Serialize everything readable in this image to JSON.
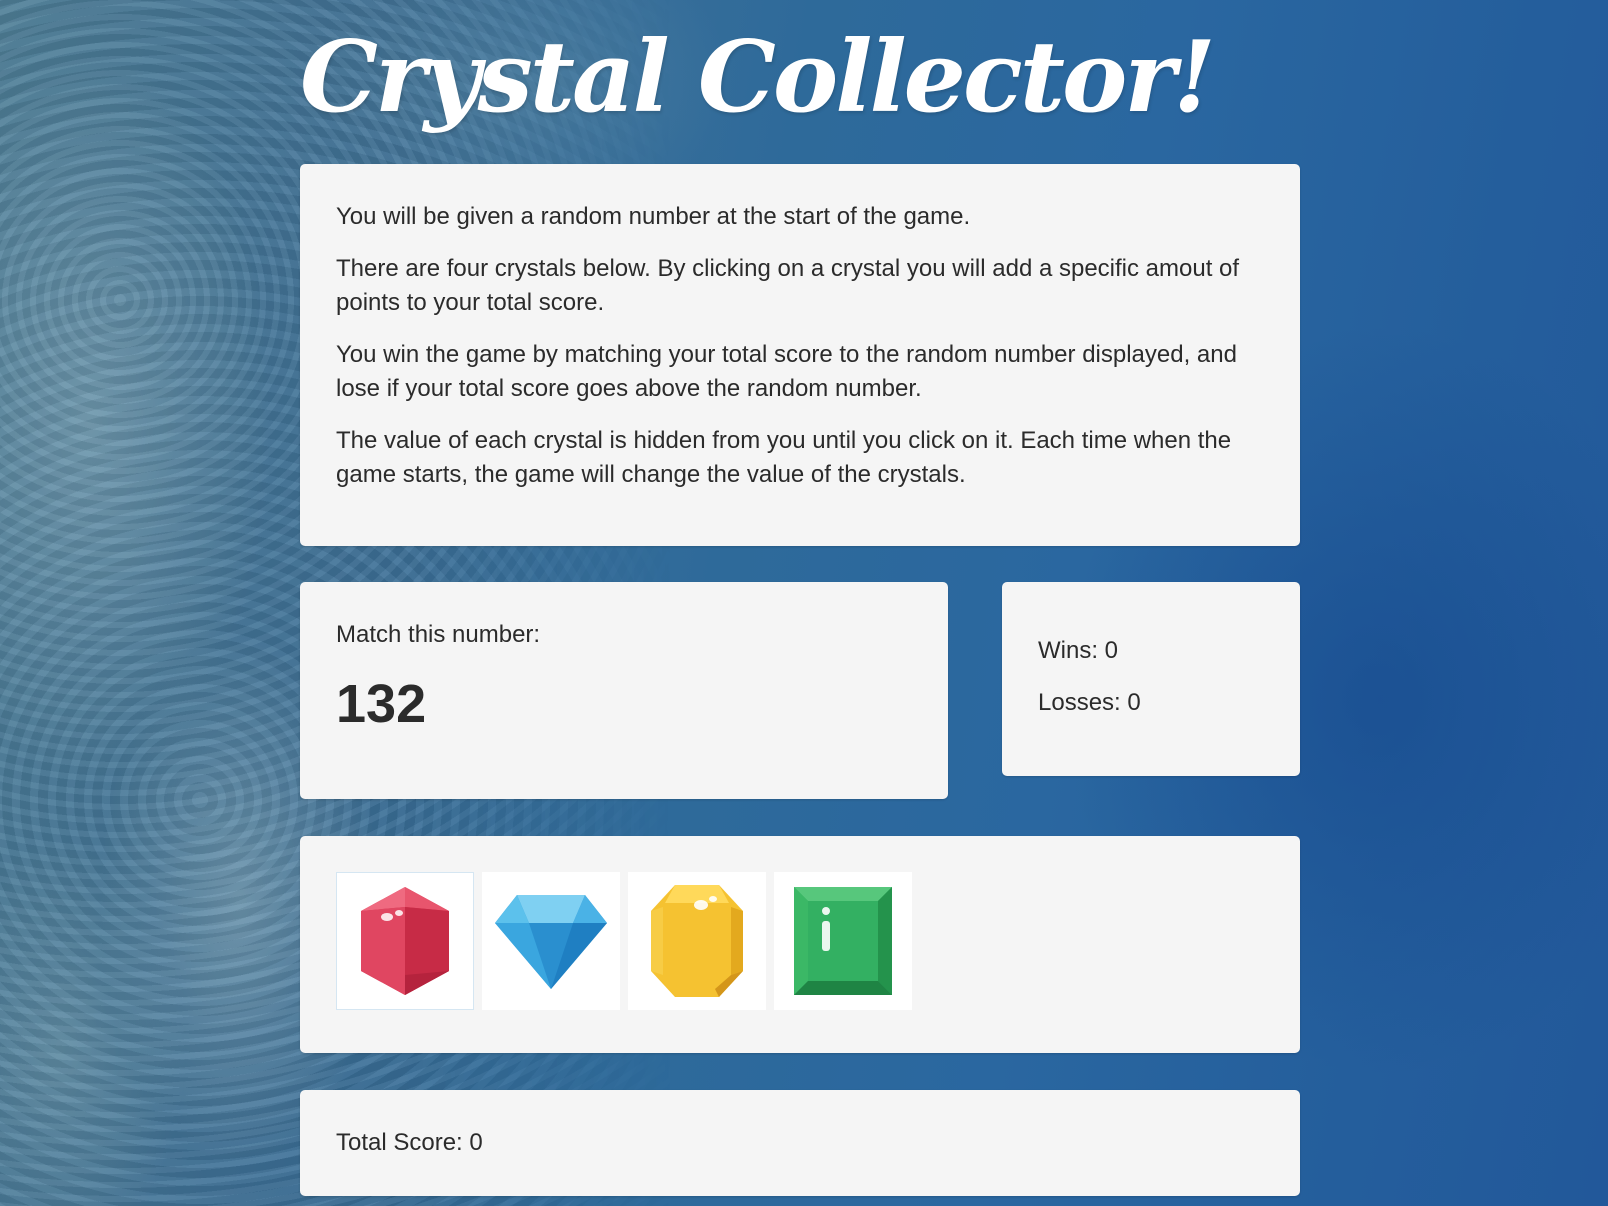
{
  "title": "Crystal Collector!",
  "instructions": [
    "You will be given a random number at the start of the game.",
    "There are four crystals below. By clicking on a crystal you will add a specific amout of points to your total score.",
    "You win the game by matching your total score to the random number displayed, and lose if your total score goes above the random number.",
    "The value of each crystal is hidden from you until you click on it. Each time when the game starts, the game will change the value of the crystals."
  ],
  "target": {
    "label": "Match this number:",
    "value": "132"
  },
  "scoreboard": {
    "wins": "Wins: 0",
    "losses": "Losses: 0"
  },
  "crystals": [
    {
      "name": "ruby-crystal-icon",
      "color": "#d9334f"
    },
    {
      "name": "diamond-crystal-icon",
      "color": "#2f9ad8"
    },
    {
      "name": "topaz-crystal-icon",
      "color": "#f5c231"
    },
    {
      "name": "emerald-crystal-icon",
      "color": "#2ea95a"
    }
  ],
  "total": {
    "label": "Total Score: 0"
  }
}
